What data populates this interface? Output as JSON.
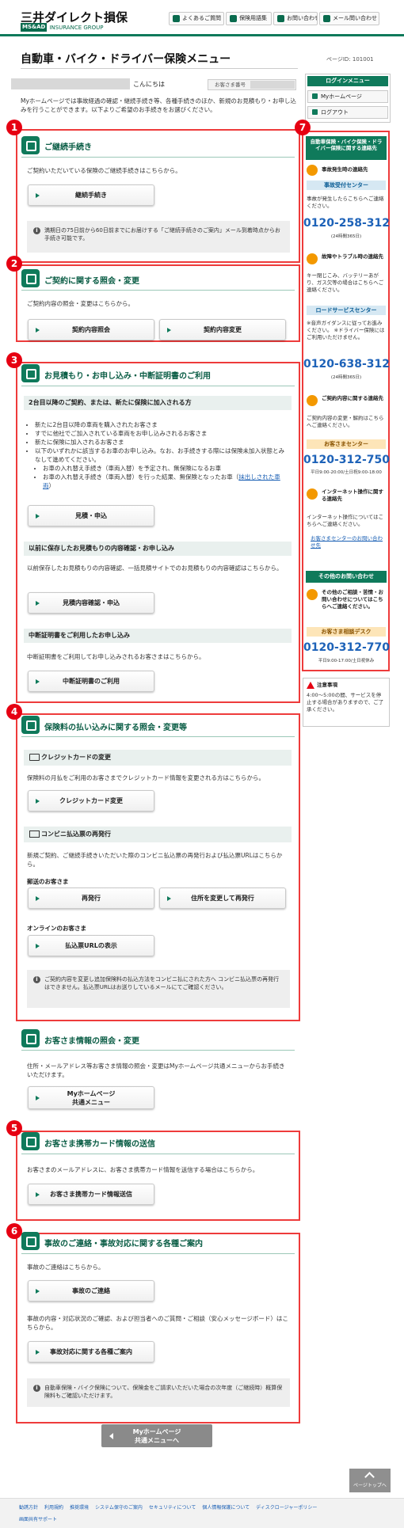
{
  "header": {
    "logo_jp": "三井ダイレクト損保",
    "logo_ms": "MS&AD",
    "logo_en": "INSURANCE GROUP",
    "nav": [
      "よくあるご質問",
      "保険用語集",
      "お問い合わせ",
      "メール問い合わせ"
    ]
  },
  "page": {
    "title": "自動車・バイク・ドライバー保険メニュー",
    "page_id": "ページID: 101001",
    "greeting_suffix": "こんにちは",
    "customer_no_label": "お客さま番号",
    "intro": "Myホームページでは事故経過の確認・継続手続き等、各種手続きのほか、新規のお見積もり・お申し込みを行うことができます。以下よりご希望のお手続きをお選びください。"
  },
  "sec1": {
    "num": "1",
    "title": "ご継続手続き",
    "text": "ご契約いただいている保険のご継続手続きはこちらから。",
    "button": "継続手続き",
    "info": "満期日の75日前から60日前までにお届けする「ご継続手続きのご案内」メール到着時点からお手続き可能です。"
  },
  "sec2": {
    "num": "2",
    "title": "ご契約に関する照会・変更",
    "text": "ご契約内容の照会・変更はこちらから。",
    "button1": "契約内容照会",
    "button2": "契約内容変更"
  },
  "sec3": {
    "num": "3",
    "title": "お見積もり・お申し込み・中断証明書のご利用",
    "sub1": "2台目以降のご契約、または、新たに保険に加入される方",
    "bullets": [
      "新たに2台目以降の車両を購入されたお客さま",
      "すでに他社でご加入されている車両をお申し込みされるお客さま",
      "新たに保険に加入されるお客さま",
      "以下のいずれかに該当するお車のお申し込み。なお、お手続きする際には保険未加入状態とみなして進めてください。"
    ],
    "sub_bullet1": "お車の入れ替え手続き（車両入替）を予定され、無保険になるお車",
    "sub_bullet2": "お車の入れ替え手続き（車両入替）を行った結果、無保険となったお車（",
    "sub_bullet2_link": "抹出しされた車両",
    "sub_bullet2_end": "）",
    "button1": "見積・申込",
    "sub2": "以前に保存したお見積もりの内容確認・お申し込み",
    "text2": "以前保存したお見積もりの内容確認、一括見積サイトでのお見積もりの内容確認はこちらから。",
    "button2": "見積内容確認・申込",
    "sub3": "中断証明書をご利用したお申し込み",
    "text3": "中断証明書をご利用してお申し込みされるお客さまはこちらから。",
    "button3": "中断証明書のご利用"
  },
  "sec4": {
    "num": "4",
    "title": "保険料の払い込みに関する照会・変更等",
    "sub1": "クレジットカードの変更",
    "text1": "保険料の月払をご利用のお客さまでクレジットカード情報を変更される方はこちらから。",
    "button1": "クレジットカード変更",
    "sub2": "コンビニ払込票の再発行",
    "text2": "新規ご契約、ご継続手続きいただいた際のコンビニ払込票の再発行および払込票URLはこちらから。",
    "label_mail": "郵送のお客さま",
    "button2": "再発行",
    "button3": "住所を変更して再発行",
    "label_online": "オンラインのお客さま",
    "button4": "払込票URLの表示",
    "info": "ご契約内容を変更し追加保険料の払込方法をコンビニ払にされた方へ コンビニ払込票の再発行はできません。払込票URLはお送りしているメールにてご確認ください。"
  },
  "sec_customer": {
    "title": "お客さま情報の照会・変更",
    "text": "住所・メールアドレス等お客さま情報の照会・変更はMyホームページ共通メニューからお手続きいただけます。",
    "button_l1": "Myホームページ",
    "button_l2": "共通メニュー"
  },
  "sec5": {
    "num": "5",
    "title": "お客さま携帯カード情報の送信",
    "text": "お客さまのメールアドレスに、お客さま携帯カード情報を送信する場合はこちらから。",
    "button": "お客さま携帯カード情報送信"
  },
  "sec6": {
    "num": "6",
    "title": "事故のご連絡・事故対応に関する各種ご案内",
    "text1": "事故のご連絡はこちらから。",
    "button1": "事故のご連絡",
    "text2": "事故の内容・対応状況のご確認、および担当者へのご質問・ご相談（安心メッセージボード）はこちらから。",
    "button2": "事故対応に関する各種ご案内",
    "info": "自動車保険・バイク保険について、保険金をご請求いただいた場合の次年度（ご継続時）概算保険料もご確認いただけます。"
  },
  "bottom_button_l1": "Myホームページ",
  "bottom_button_l2": "共通メニューへ",
  "pagetop": "ページトップへ",
  "sidebar": {
    "login_menu": "ログインメニュー",
    "myhome": "Myホームページ",
    "logout": "ログアウト",
    "num": "7",
    "contact_title": "自動車保険・バイク保険・ドライバー保険に関する連絡先",
    "accident_title": "事故発生時の連絡先",
    "accident_center": "事故受付センター",
    "accident_text": "事故が発生したらこちらへご連絡ください。",
    "accident_phone": "0120-258-312",
    "accident_hours": "(24時間365日)",
    "trouble_title": "故障やトラブル時の連絡先",
    "trouble_text": "キー閉じこみ、バッテリーあがり、ガス欠等の場合はこちらへご連絡ください。",
    "road_center": "ロードサービスセンター",
    "road_note": "※音声ガイダンスに従ってお進みください。 ※ドライバー保険にはご利用いただけません。",
    "road_phone": "0120-638-312",
    "road_hours": "(24時間365日)",
    "contract_title": "ご契約内容に関する連絡先",
    "contract_text": "ご契約内容の変更・解約はこちらへご連絡ください。",
    "customer_center": "お客さまセンター",
    "customer_phone": "0120-312-750",
    "customer_hours": "平日9:00-20:00/土日祝9:00-18:00",
    "internet_title": "インターネット操作に関する連絡先",
    "internet_text": "インターネット操作についてはこちらへご連絡ください。",
    "internet_link": "お客さまセンターのお問い合わせ先",
    "other_head": "その他のお問い合わせ",
    "other_title": "その他のご相談・苦情・お問い合わせについてはこちらへご連絡ください。",
    "consult_desk": "お客さま相談デスク",
    "consult_phone": "0120-312-770",
    "consult_hours": "平日9:00-17:00/土日祝休み",
    "notice_title": "注意事項",
    "notice_text": "4:00〜5:00の間、サービスを停止する場合がありますので、ご了承ください。"
  },
  "footer": {
    "links": [
      "勧誘方針",
      "利用規約",
      "推奨環境",
      "システム保守のご案内",
      "セキュリティについて",
      "個人情報保護について",
      "ディスクロージャーポリシー"
    ],
    "links2": [
      "画面共有サポート"
    ]
  }
}
